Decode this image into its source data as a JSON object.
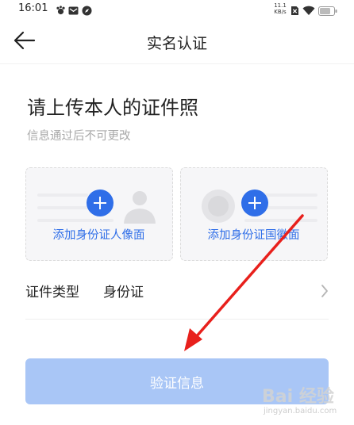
{
  "status_bar": {
    "time": "16:01",
    "net_speed_value": "11.1",
    "net_speed_unit": "KB/s",
    "icons": [
      "paw-icon",
      "mail-icon",
      "compass-icon",
      "no-sim-icon",
      "wifi-icon",
      "battery-icon"
    ]
  },
  "nav": {
    "title": "实名认证",
    "back_icon": "arrow-left-icon"
  },
  "header": {
    "title": "请上传本人的证件照",
    "subtitle": "信息通过后不可更改"
  },
  "upload": {
    "front": {
      "label": "添加身份证人像面",
      "icon": "plus-icon"
    },
    "back": {
      "label": "添加身份证国徽面",
      "icon": "plus-icon"
    }
  },
  "id_type": {
    "label": "证件类型",
    "value": "身份证",
    "icon": "chevron-right-icon"
  },
  "verify_button": {
    "label": "验证信息"
  },
  "watermark": {
    "main": "Bai 经验",
    "sub": "jingyan.baidu.com"
  },
  "colors": {
    "primary": "#2f6ee8",
    "button_disabled": "#a9c6f6",
    "arrow": "#e8201c",
    "card_bg": "#f6f6f8"
  }
}
